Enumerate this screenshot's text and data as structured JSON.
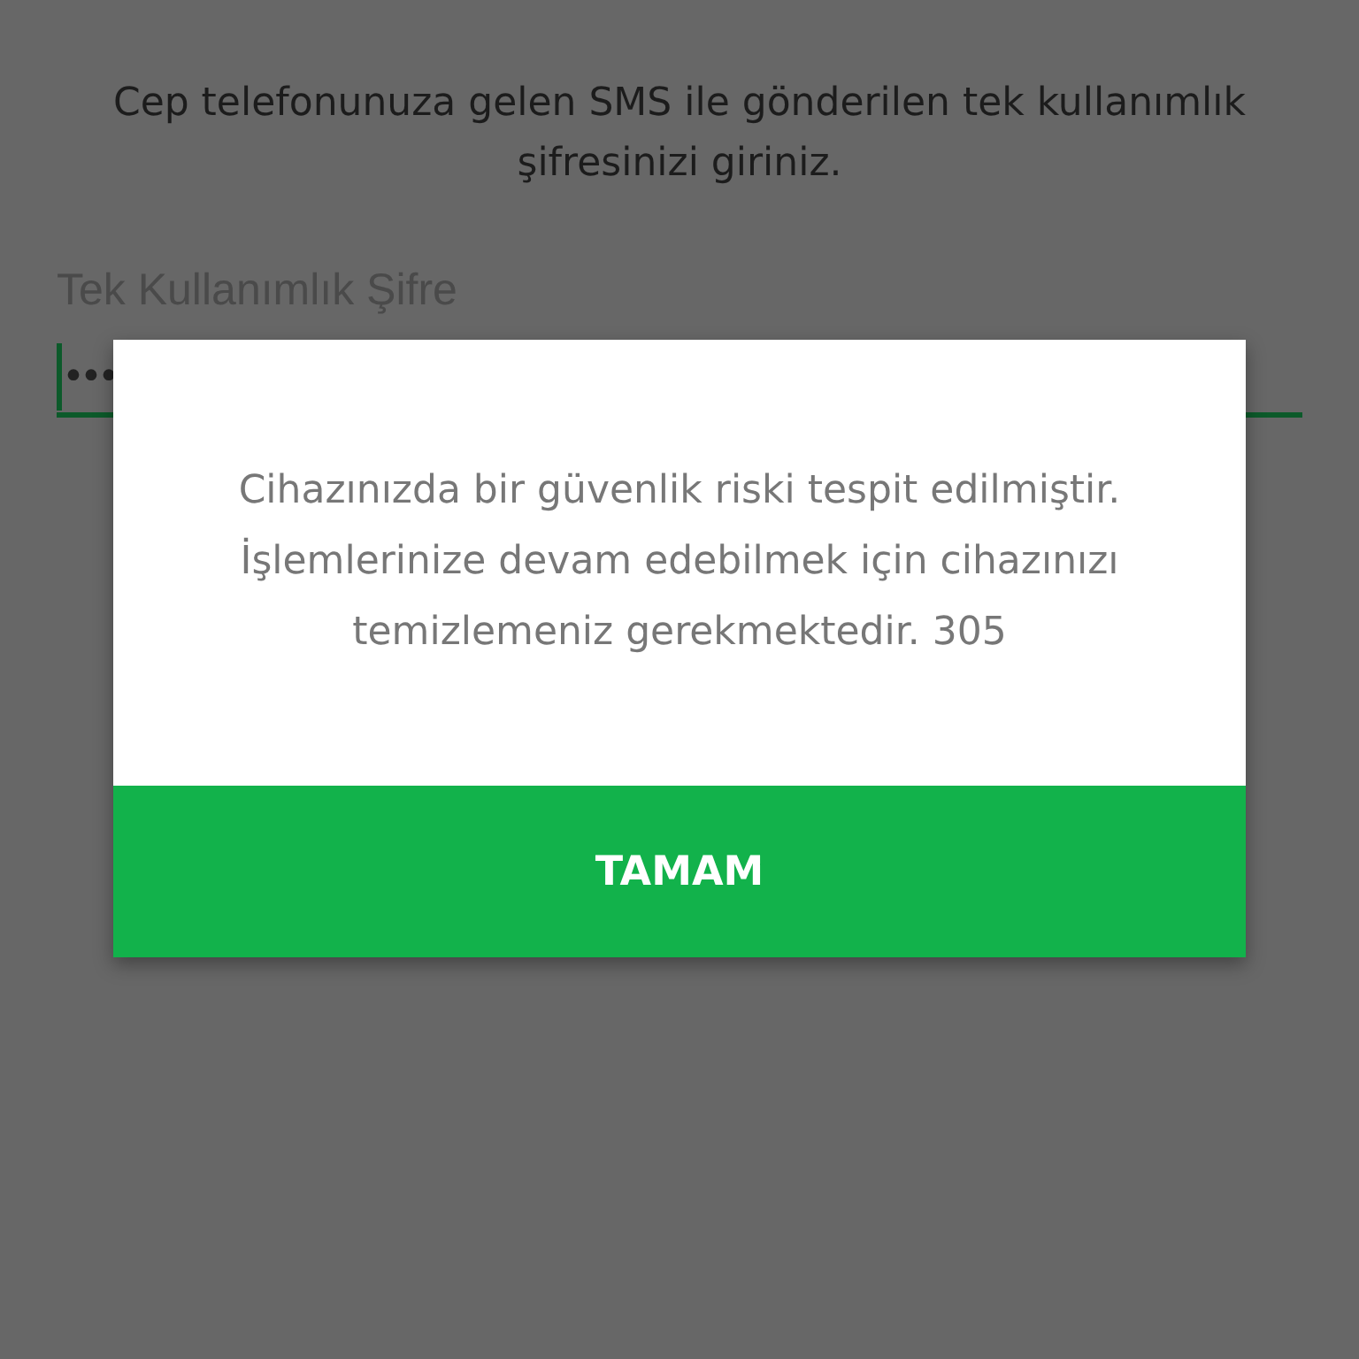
{
  "instruction": "Cep telefonunuza gelen SMS ile gönderilen tek kullanımlık şifresinizi giriniz.",
  "otp_field": {
    "label": "Tek Kullanımlık Şifre",
    "value": "•••"
  },
  "dialog": {
    "message": "Cihazınızda bir güvenlik riski tespit edilmiştir. İşlemlerinize devam edebilmek için cihazınızı temizlemeniz gerekmektedir. 305",
    "button": "TAMAM"
  }
}
